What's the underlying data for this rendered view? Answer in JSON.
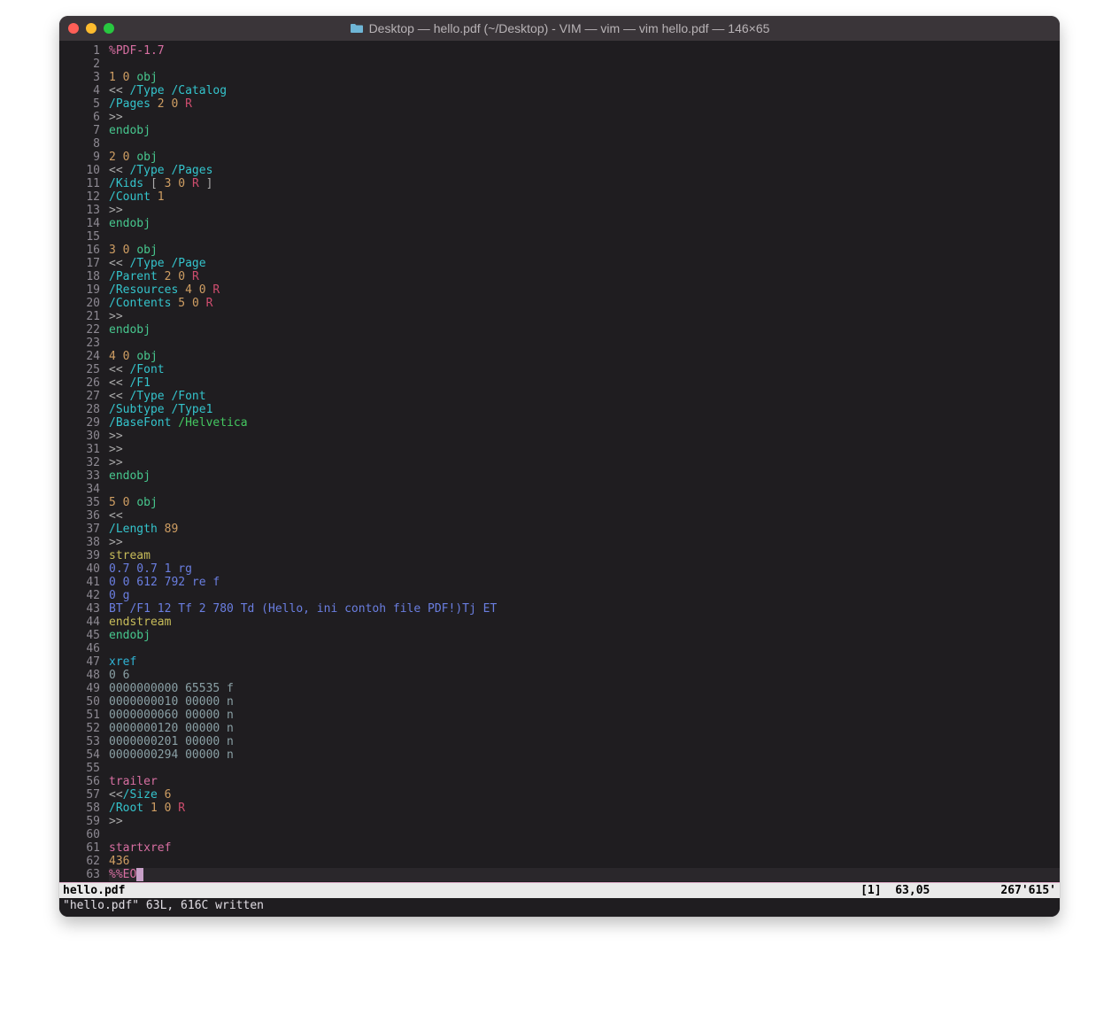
{
  "window": {
    "title": "Desktop — hello.pdf (~/Desktop) - VIM — vim — vim hello.pdf — 146×65"
  },
  "statusbar": {
    "filename": "hello.pdf",
    "indicator": "[1]",
    "cursor": "63,05",
    "right": "267'615'"
  },
  "message": "\"hello.pdf\" 63L, 616C written",
  "lines": [
    {
      "n": 1,
      "tokens": [
        [
          "%PDF-1.7",
          "c-pink"
        ]
      ]
    },
    {
      "n": 2,
      "tokens": []
    },
    {
      "n": 3,
      "tokens": [
        [
          "1",
          "c-num"
        ],
        [
          " ",
          " "
        ],
        [
          "0",
          "c-num"
        ],
        [
          " ",
          " "
        ],
        [
          "obj",
          "c-obj"
        ]
      ]
    },
    {
      "n": 4,
      "tokens": [
        [
          "<< ",
          "c-gray"
        ],
        [
          "/Type",
          "c-key"
        ],
        [
          " ",
          " "
        ],
        [
          "/Catalog",
          "c-key"
        ]
      ]
    },
    {
      "n": 5,
      "tokens": [
        [
          "/Pages",
          "c-key"
        ],
        [
          " ",
          " "
        ],
        [
          "2",
          "c-num"
        ],
        [
          " ",
          " "
        ],
        [
          "0",
          "c-num"
        ],
        [
          " ",
          " "
        ],
        [
          "R",
          "c-R"
        ]
      ]
    },
    {
      "n": 6,
      "tokens": [
        [
          ">>",
          "c-gray"
        ]
      ]
    },
    {
      "n": 7,
      "tokens": [
        [
          "endobj",
          "c-obj"
        ]
      ]
    },
    {
      "n": 8,
      "tokens": []
    },
    {
      "n": 9,
      "tokens": [
        [
          "2",
          "c-num"
        ],
        [
          " ",
          " "
        ],
        [
          "0",
          "c-num"
        ],
        [
          " ",
          " "
        ],
        [
          "obj",
          "c-obj"
        ]
      ]
    },
    {
      "n": 10,
      "tokens": [
        [
          "<< ",
          "c-gray"
        ],
        [
          "/Type",
          "c-key"
        ],
        [
          " ",
          " "
        ],
        [
          "/Pages",
          "c-key"
        ]
      ]
    },
    {
      "n": 11,
      "tokens": [
        [
          "/Kids",
          "c-key"
        ],
        [
          " [ ",
          "c-gray"
        ],
        [
          "3",
          "c-num"
        ],
        [
          " ",
          " "
        ],
        [
          "0",
          "c-num"
        ],
        [
          " ",
          " "
        ],
        [
          "R",
          "c-R"
        ],
        [
          " ]",
          "c-gray"
        ]
      ]
    },
    {
      "n": 12,
      "tokens": [
        [
          "/Count",
          "c-key"
        ],
        [
          " ",
          " "
        ],
        [
          "1",
          "c-num"
        ]
      ]
    },
    {
      "n": 13,
      "tokens": [
        [
          ">>",
          "c-gray"
        ]
      ]
    },
    {
      "n": 14,
      "tokens": [
        [
          "endobj",
          "c-obj"
        ]
      ]
    },
    {
      "n": 15,
      "tokens": []
    },
    {
      "n": 16,
      "tokens": [
        [
          "3",
          "c-num"
        ],
        [
          " ",
          " "
        ],
        [
          "0",
          "c-num"
        ],
        [
          " ",
          " "
        ],
        [
          "obj",
          "c-obj"
        ]
      ]
    },
    {
      "n": 17,
      "tokens": [
        [
          "<< ",
          "c-gray"
        ],
        [
          "/Type",
          "c-key"
        ],
        [
          " ",
          " "
        ],
        [
          "/Page",
          "c-key"
        ]
      ]
    },
    {
      "n": 18,
      "tokens": [
        [
          "/Parent",
          "c-key"
        ],
        [
          " ",
          " "
        ],
        [
          "2",
          "c-num"
        ],
        [
          " ",
          " "
        ],
        [
          "0",
          "c-num"
        ],
        [
          " ",
          " "
        ],
        [
          "R",
          "c-R"
        ]
      ]
    },
    {
      "n": 19,
      "tokens": [
        [
          "/Resources",
          "c-key"
        ],
        [
          " ",
          " "
        ],
        [
          "4",
          "c-num"
        ],
        [
          " ",
          " "
        ],
        [
          "0",
          "c-num"
        ],
        [
          " ",
          " "
        ],
        [
          "R",
          "c-R"
        ]
      ]
    },
    {
      "n": 20,
      "tokens": [
        [
          "/Contents",
          "c-key"
        ],
        [
          " ",
          " "
        ],
        [
          "5",
          "c-num"
        ],
        [
          " ",
          " "
        ],
        [
          "0",
          "c-num"
        ],
        [
          " ",
          " "
        ],
        [
          "R",
          "c-R"
        ]
      ]
    },
    {
      "n": 21,
      "tokens": [
        [
          ">>",
          "c-gray"
        ]
      ]
    },
    {
      "n": 22,
      "tokens": [
        [
          "endobj",
          "c-obj"
        ]
      ]
    },
    {
      "n": 23,
      "tokens": []
    },
    {
      "n": 24,
      "tokens": [
        [
          "4",
          "c-num"
        ],
        [
          " ",
          " "
        ],
        [
          "0",
          "c-num"
        ],
        [
          " ",
          " "
        ],
        [
          "obj",
          "c-obj"
        ]
      ]
    },
    {
      "n": 25,
      "tokens": [
        [
          "<< ",
          "c-gray"
        ],
        [
          "/Font",
          "c-key"
        ]
      ]
    },
    {
      "n": 26,
      "tokens": [
        [
          "<< ",
          "c-gray"
        ],
        [
          "/F1",
          "c-key"
        ]
      ]
    },
    {
      "n": 27,
      "tokens": [
        [
          "<< ",
          "c-gray"
        ],
        [
          "/Type",
          "c-key"
        ],
        [
          " ",
          " "
        ],
        [
          "/Font",
          "c-key"
        ]
      ]
    },
    {
      "n": 28,
      "tokens": [
        [
          "/Subtype",
          "c-key"
        ],
        [
          " ",
          " "
        ],
        [
          "/Type1",
          "c-key"
        ]
      ]
    },
    {
      "n": 29,
      "tokens": [
        [
          "/BaseFont",
          "c-key"
        ],
        [
          " ",
          " "
        ],
        [
          "/Helvetica",
          "c-green"
        ]
      ]
    },
    {
      "n": 30,
      "tokens": [
        [
          ">>",
          "c-gray"
        ]
      ]
    },
    {
      "n": 31,
      "tokens": [
        [
          ">>",
          "c-gray"
        ]
      ]
    },
    {
      "n": 32,
      "tokens": [
        [
          ">>",
          "c-gray"
        ]
      ]
    },
    {
      "n": 33,
      "tokens": [
        [
          "endobj",
          "c-obj"
        ]
      ]
    },
    {
      "n": 34,
      "tokens": []
    },
    {
      "n": 35,
      "tokens": [
        [
          "5",
          "c-num"
        ],
        [
          " ",
          " "
        ],
        [
          "0",
          "c-num"
        ],
        [
          " ",
          " "
        ],
        [
          "obj",
          "c-obj"
        ]
      ]
    },
    {
      "n": 36,
      "tokens": [
        [
          "<<",
          "c-gray"
        ]
      ]
    },
    {
      "n": 37,
      "tokens": [
        [
          "/Length",
          "c-key"
        ],
        [
          " ",
          " "
        ],
        [
          "89",
          "c-num"
        ]
      ]
    },
    {
      "n": 38,
      "tokens": [
        [
          ">>",
          "c-gray"
        ]
      ]
    },
    {
      "n": 39,
      "tokens": [
        [
          "stream",
          "c-yel"
        ]
      ]
    },
    {
      "n": 40,
      "tokens": [
        [
          "0.7 0.7 1 rg",
          "c-blue"
        ]
      ]
    },
    {
      "n": 41,
      "tokens": [
        [
          "0 0 612 792 re f",
          "c-blue"
        ]
      ]
    },
    {
      "n": 42,
      "tokens": [
        [
          "0 g",
          "c-blue"
        ]
      ]
    },
    {
      "n": 43,
      "tokens": [
        [
          "BT /F1 12 Tf 2 780 Td (Hello, ini contoh file PDF!)Tj ET",
          "c-blue"
        ]
      ]
    },
    {
      "n": 44,
      "tokens": [
        [
          "endstream",
          "c-yel"
        ]
      ]
    },
    {
      "n": 45,
      "tokens": [
        [
          "endobj",
          "c-obj"
        ]
      ]
    },
    {
      "n": 46,
      "tokens": []
    },
    {
      "n": 47,
      "tokens": [
        [
          "xref",
          "c-cyan"
        ]
      ]
    },
    {
      "n": 48,
      "tokens": [
        [
          "0 6",
          "c-dim"
        ]
      ]
    },
    {
      "n": 49,
      "tokens": [
        [
          "0000000000 65535 f",
          "c-dim"
        ]
      ]
    },
    {
      "n": 50,
      "tokens": [
        [
          "0000000010 00000 n",
          "c-dim"
        ]
      ]
    },
    {
      "n": 51,
      "tokens": [
        [
          "0000000060 00000 n",
          "c-dim"
        ]
      ]
    },
    {
      "n": 52,
      "tokens": [
        [
          "0000000120 00000 n",
          "c-dim"
        ]
      ]
    },
    {
      "n": 53,
      "tokens": [
        [
          "0000000201 00000 n",
          "c-dim"
        ]
      ]
    },
    {
      "n": 54,
      "tokens": [
        [
          "0000000294 00000 n",
          "c-dim"
        ]
      ]
    },
    {
      "n": 55,
      "tokens": []
    },
    {
      "n": 56,
      "tokens": [
        [
          "trailer",
          "c-pink"
        ]
      ]
    },
    {
      "n": 57,
      "tokens": [
        [
          "<<",
          "c-gray"
        ],
        [
          "/Size",
          "c-key"
        ],
        [
          " ",
          " "
        ],
        [
          "6",
          "c-num"
        ]
      ]
    },
    {
      "n": 58,
      "tokens": [
        [
          "/Root",
          "c-key"
        ],
        [
          " ",
          " "
        ],
        [
          "1",
          "c-num"
        ],
        [
          " ",
          " "
        ],
        [
          "0",
          "c-num"
        ],
        [
          " ",
          " "
        ],
        [
          "R",
          "c-R"
        ]
      ]
    },
    {
      "n": 59,
      "tokens": [
        [
          ">>",
          "c-gray"
        ]
      ]
    },
    {
      "n": 60,
      "tokens": []
    },
    {
      "n": 61,
      "tokens": [
        [
          "startxref",
          "c-pink"
        ]
      ]
    },
    {
      "n": 62,
      "tokens": [
        [
          "436",
          "c-num"
        ]
      ]
    },
    {
      "n": 63,
      "tokens": [
        [
          "%%EO",
          "c-pink"
        ]
      ],
      "cursor": true
    }
  ]
}
